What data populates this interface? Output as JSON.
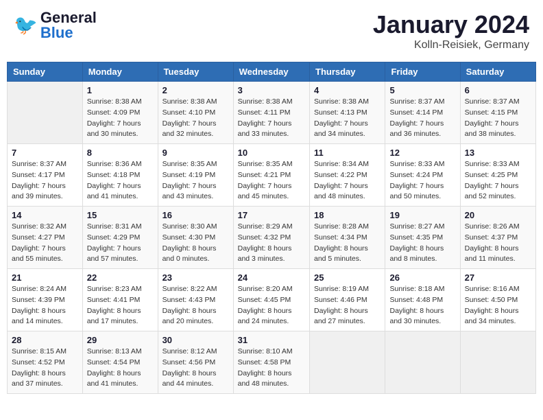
{
  "header": {
    "logo_general": "General",
    "logo_blue": "Blue",
    "title": "January 2024",
    "location": "Kolln-Reisiek, Germany"
  },
  "weekdays": [
    "Sunday",
    "Monday",
    "Tuesday",
    "Wednesday",
    "Thursday",
    "Friday",
    "Saturday"
  ],
  "weeks": [
    [
      {
        "day": "",
        "sunrise": "",
        "sunset": "",
        "daylight": ""
      },
      {
        "day": "1",
        "sunrise": "Sunrise: 8:38 AM",
        "sunset": "Sunset: 4:09 PM",
        "daylight": "Daylight: 7 hours and 30 minutes."
      },
      {
        "day": "2",
        "sunrise": "Sunrise: 8:38 AM",
        "sunset": "Sunset: 4:10 PM",
        "daylight": "Daylight: 7 hours and 32 minutes."
      },
      {
        "day": "3",
        "sunrise": "Sunrise: 8:38 AM",
        "sunset": "Sunset: 4:11 PM",
        "daylight": "Daylight: 7 hours and 33 minutes."
      },
      {
        "day": "4",
        "sunrise": "Sunrise: 8:38 AM",
        "sunset": "Sunset: 4:13 PM",
        "daylight": "Daylight: 7 hours and 34 minutes."
      },
      {
        "day": "5",
        "sunrise": "Sunrise: 8:37 AM",
        "sunset": "Sunset: 4:14 PM",
        "daylight": "Daylight: 7 hours and 36 minutes."
      },
      {
        "day": "6",
        "sunrise": "Sunrise: 8:37 AM",
        "sunset": "Sunset: 4:15 PM",
        "daylight": "Daylight: 7 hours and 38 minutes."
      }
    ],
    [
      {
        "day": "7",
        "sunrise": "Sunrise: 8:37 AM",
        "sunset": "Sunset: 4:17 PM",
        "daylight": "Daylight: 7 hours and 39 minutes."
      },
      {
        "day": "8",
        "sunrise": "Sunrise: 8:36 AM",
        "sunset": "Sunset: 4:18 PM",
        "daylight": "Daylight: 7 hours and 41 minutes."
      },
      {
        "day": "9",
        "sunrise": "Sunrise: 8:35 AM",
        "sunset": "Sunset: 4:19 PM",
        "daylight": "Daylight: 7 hours and 43 minutes."
      },
      {
        "day": "10",
        "sunrise": "Sunrise: 8:35 AM",
        "sunset": "Sunset: 4:21 PM",
        "daylight": "Daylight: 7 hours and 45 minutes."
      },
      {
        "day": "11",
        "sunrise": "Sunrise: 8:34 AM",
        "sunset": "Sunset: 4:22 PM",
        "daylight": "Daylight: 7 hours and 48 minutes."
      },
      {
        "day": "12",
        "sunrise": "Sunrise: 8:33 AM",
        "sunset": "Sunset: 4:24 PM",
        "daylight": "Daylight: 7 hours and 50 minutes."
      },
      {
        "day": "13",
        "sunrise": "Sunrise: 8:33 AM",
        "sunset": "Sunset: 4:25 PM",
        "daylight": "Daylight: 7 hours and 52 minutes."
      }
    ],
    [
      {
        "day": "14",
        "sunrise": "Sunrise: 8:32 AM",
        "sunset": "Sunset: 4:27 PM",
        "daylight": "Daylight: 7 hours and 55 minutes."
      },
      {
        "day": "15",
        "sunrise": "Sunrise: 8:31 AM",
        "sunset": "Sunset: 4:29 PM",
        "daylight": "Daylight: 7 hours and 57 minutes."
      },
      {
        "day": "16",
        "sunrise": "Sunrise: 8:30 AM",
        "sunset": "Sunset: 4:30 PM",
        "daylight": "Daylight: 8 hours and 0 minutes."
      },
      {
        "day": "17",
        "sunrise": "Sunrise: 8:29 AM",
        "sunset": "Sunset: 4:32 PM",
        "daylight": "Daylight: 8 hours and 3 minutes."
      },
      {
        "day": "18",
        "sunrise": "Sunrise: 8:28 AM",
        "sunset": "Sunset: 4:34 PM",
        "daylight": "Daylight: 8 hours and 5 minutes."
      },
      {
        "day": "19",
        "sunrise": "Sunrise: 8:27 AM",
        "sunset": "Sunset: 4:35 PM",
        "daylight": "Daylight: 8 hours and 8 minutes."
      },
      {
        "day": "20",
        "sunrise": "Sunrise: 8:26 AM",
        "sunset": "Sunset: 4:37 PM",
        "daylight": "Daylight: 8 hours and 11 minutes."
      }
    ],
    [
      {
        "day": "21",
        "sunrise": "Sunrise: 8:24 AM",
        "sunset": "Sunset: 4:39 PM",
        "daylight": "Daylight: 8 hours and 14 minutes."
      },
      {
        "day": "22",
        "sunrise": "Sunrise: 8:23 AM",
        "sunset": "Sunset: 4:41 PM",
        "daylight": "Daylight: 8 hours and 17 minutes."
      },
      {
        "day": "23",
        "sunrise": "Sunrise: 8:22 AM",
        "sunset": "Sunset: 4:43 PM",
        "daylight": "Daylight: 8 hours and 20 minutes."
      },
      {
        "day": "24",
        "sunrise": "Sunrise: 8:20 AM",
        "sunset": "Sunset: 4:45 PM",
        "daylight": "Daylight: 8 hours and 24 minutes."
      },
      {
        "day": "25",
        "sunrise": "Sunrise: 8:19 AM",
        "sunset": "Sunset: 4:46 PM",
        "daylight": "Daylight: 8 hours and 27 minutes."
      },
      {
        "day": "26",
        "sunrise": "Sunrise: 8:18 AM",
        "sunset": "Sunset: 4:48 PM",
        "daylight": "Daylight: 8 hours and 30 minutes."
      },
      {
        "day": "27",
        "sunrise": "Sunrise: 8:16 AM",
        "sunset": "Sunset: 4:50 PM",
        "daylight": "Daylight: 8 hours and 34 minutes."
      }
    ],
    [
      {
        "day": "28",
        "sunrise": "Sunrise: 8:15 AM",
        "sunset": "Sunset: 4:52 PM",
        "daylight": "Daylight: 8 hours and 37 minutes."
      },
      {
        "day": "29",
        "sunrise": "Sunrise: 8:13 AM",
        "sunset": "Sunset: 4:54 PM",
        "daylight": "Daylight: 8 hours and 41 minutes."
      },
      {
        "day": "30",
        "sunrise": "Sunrise: 8:12 AM",
        "sunset": "Sunset: 4:56 PM",
        "daylight": "Daylight: 8 hours and 44 minutes."
      },
      {
        "day": "31",
        "sunrise": "Sunrise: 8:10 AM",
        "sunset": "Sunset: 4:58 PM",
        "daylight": "Daylight: 8 hours and 48 minutes."
      },
      {
        "day": "",
        "sunrise": "",
        "sunset": "",
        "daylight": ""
      },
      {
        "day": "",
        "sunrise": "",
        "sunset": "",
        "daylight": ""
      },
      {
        "day": "",
        "sunrise": "",
        "sunset": "",
        "daylight": ""
      }
    ]
  ]
}
